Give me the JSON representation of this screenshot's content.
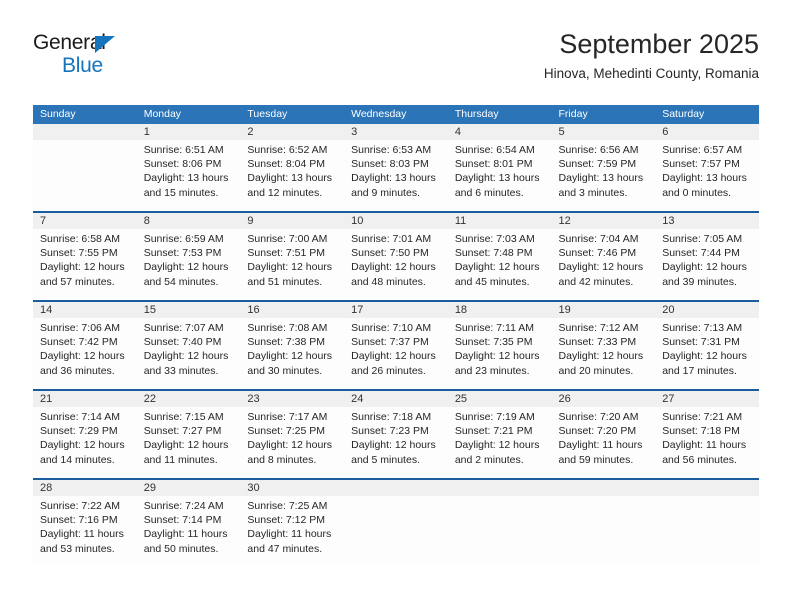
{
  "brand": {
    "name_top": "General",
    "name_bottom": "Blue",
    "accent_color": "#1574bb"
  },
  "header": {
    "title": "September 2025",
    "subtitle": "Hinova, Mehedinti County, Romania"
  },
  "theme": {
    "header_bg": "#2b74b8",
    "week_divider": "#1b5c9e",
    "daynum_bg": "#f0f0f0",
    "cell_bg": "#fdfdfd"
  },
  "calendar": {
    "weekday_headers": [
      "Sunday",
      "Monday",
      "Tuesday",
      "Wednesday",
      "Thursday",
      "Friday",
      "Saturday"
    ],
    "weeks": [
      [
        {
          "day": ""
        },
        {
          "day": "1",
          "sunrise": "Sunrise: 6:51 AM",
          "sunset": "Sunset: 8:06 PM",
          "daylight_l1": "Daylight: 13 hours",
          "daylight_l2": "and 15 minutes."
        },
        {
          "day": "2",
          "sunrise": "Sunrise: 6:52 AM",
          "sunset": "Sunset: 8:04 PM",
          "daylight_l1": "Daylight: 13 hours",
          "daylight_l2": "and 12 minutes."
        },
        {
          "day": "3",
          "sunrise": "Sunrise: 6:53 AM",
          "sunset": "Sunset: 8:03 PM",
          "daylight_l1": "Daylight: 13 hours",
          "daylight_l2": "and 9 minutes."
        },
        {
          "day": "4",
          "sunrise": "Sunrise: 6:54 AM",
          "sunset": "Sunset: 8:01 PM",
          "daylight_l1": "Daylight: 13 hours",
          "daylight_l2": "and 6 minutes."
        },
        {
          "day": "5",
          "sunrise": "Sunrise: 6:56 AM",
          "sunset": "Sunset: 7:59 PM",
          "daylight_l1": "Daylight: 13 hours",
          "daylight_l2": "and 3 minutes."
        },
        {
          "day": "6",
          "sunrise": "Sunrise: 6:57 AM",
          "sunset": "Sunset: 7:57 PM",
          "daylight_l1": "Daylight: 13 hours",
          "daylight_l2": "and 0 minutes."
        }
      ],
      [
        {
          "day": "7",
          "sunrise": "Sunrise: 6:58 AM",
          "sunset": "Sunset: 7:55 PM",
          "daylight_l1": "Daylight: 12 hours",
          "daylight_l2": "and 57 minutes."
        },
        {
          "day": "8",
          "sunrise": "Sunrise: 6:59 AM",
          "sunset": "Sunset: 7:53 PM",
          "daylight_l1": "Daylight: 12 hours",
          "daylight_l2": "and 54 minutes."
        },
        {
          "day": "9",
          "sunrise": "Sunrise: 7:00 AM",
          "sunset": "Sunset: 7:51 PM",
          "daylight_l1": "Daylight: 12 hours",
          "daylight_l2": "and 51 minutes."
        },
        {
          "day": "10",
          "sunrise": "Sunrise: 7:01 AM",
          "sunset": "Sunset: 7:50 PM",
          "daylight_l1": "Daylight: 12 hours",
          "daylight_l2": "and 48 minutes."
        },
        {
          "day": "11",
          "sunrise": "Sunrise: 7:03 AM",
          "sunset": "Sunset: 7:48 PM",
          "daylight_l1": "Daylight: 12 hours",
          "daylight_l2": "and 45 minutes."
        },
        {
          "day": "12",
          "sunrise": "Sunrise: 7:04 AM",
          "sunset": "Sunset: 7:46 PM",
          "daylight_l1": "Daylight: 12 hours",
          "daylight_l2": "and 42 minutes."
        },
        {
          "day": "13",
          "sunrise": "Sunrise: 7:05 AM",
          "sunset": "Sunset: 7:44 PM",
          "daylight_l1": "Daylight: 12 hours",
          "daylight_l2": "and 39 minutes."
        }
      ],
      [
        {
          "day": "14",
          "sunrise": "Sunrise: 7:06 AM",
          "sunset": "Sunset: 7:42 PM",
          "daylight_l1": "Daylight: 12 hours",
          "daylight_l2": "and 36 minutes."
        },
        {
          "day": "15",
          "sunrise": "Sunrise: 7:07 AM",
          "sunset": "Sunset: 7:40 PM",
          "daylight_l1": "Daylight: 12 hours",
          "daylight_l2": "and 33 minutes."
        },
        {
          "day": "16",
          "sunrise": "Sunrise: 7:08 AM",
          "sunset": "Sunset: 7:38 PM",
          "daylight_l1": "Daylight: 12 hours",
          "daylight_l2": "and 30 minutes."
        },
        {
          "day": "17",
          "sunrise": "Sunrise: 7:10 AM",
          "sunset": "Sunset: 7:37 PM",
          "daylight_l1": "Daylight: 12 hours",
          "daylight_l2": "and 26 minutes."
        },
        {
          "day": "18",
          "sunrise": "Sunrise: 7:11 AM",
          "sunset": "Sunset: 7:35 PM",
          "daylight_l1": "Daylight: 12 hours",
          "daylight_l2": "and 23 minutes."
        },
        {
          "day": "19",
          "sunrise": "Sunrise: 7:12 AM",
          "sunset": "Sunset: 7:33 PM",
          "daylight_l1": "Daylight: 12 hours",
          "daylight_l2": "and 20 minutes."
        },
        {
          "day": "20",
          "sunrise": "Sunrise: 7:13 AM",
          "sunset": "Sunset: 7:31 PM",
          "daylight_l1": "Daylight: 12 hours",
          "daylight_l2": "and 17 minutes."
        }
      ],
      [
        {
          "day": "21",
          "sunrise": "Sunrise: 7:14 AM",
          "sunset": "Sunset: 7:29 PM",
          "daylight_l1": "Daylight: 12 hours",
          "daylight_l2": "and 14 minutes."
        },
        {
          "day": "22",
          "sunrise": "Sunrise: 7:15 AM",
          "sunset": "Sunset: 7:27 PM",
          "daylight_l1": "Daylight: 12 hours",
          "daylight_l2": "and 11 minutes."
        },
        {
          "day": "23",
          "sunrise": "Sunrise: 7:17 AM",
          "sunset": "Sunset: 7:25 PM",
          "daylight_l1": "Daylight: 12 hours",
          "daylight_l2": "and 8 minutes."
        },
        {
          "day": "24",
          "sunrise": "Sunrise: 7:18 AM",
          "sunset": "Sunset: 7:23 PM",
          "daylight_l1": "Daylight: 12 hours",
          "daylight_l2": "and 5 minutes."
        },
        {
          "day": "25",
          "sunrise": "Sunrise: 7:19 AM",
          "sunset": "Sunset: 7:21 PM",
          "daylight_l1": "Daylight: 12 hours",
          "daylight_l2": "and 2 minutes."
        },
        {
          "day": "26",
          "sunrise": "Sunrise: 7:20 AM",
          "sunset": "Sunset: 7:20 PM",
          "daylight_l1": "Daylight: 11 hours",
          "daylight_l2": "and 59 minutes."
        },
        {
          "day": "27",
          "sunrise": "Sunrise: 7:21 AM",
          "sunset": "Sunset: 7:18 PM",
          "daylight_l1": "Daylight: 11 hours",
          "daylight_l2": "and 56 minutes."
        }
      ],
      [
        {
          "day": "28",
          "sunrise": "Sunrise: 7:22 AM",
          "sunset": "Sunset: 7:16 PM",
          "daylight_l1": "Daylight: 11 hours",
          "daylight_l2": "and 53 minutes."
        },
        {
          "day": "29",
          "sunrise": "Sunrise: 7:24 AM",
          "sunset": "Sunset: 7:14 PM",
          "daylight_l1": "Daylight: 11 hours",
          "daylight_l2": "and 50 minutes."
        },
        {
          "day": "30",
          "sunrise": "Sunrise: 7:25 AM",
          "sunset": "Sunset: 7:12 PM",
          "daylight_l1": "Daylight: 11 hours",
          "daylight_l2": "and 47 minutes."
        },
        {
          "day": ""
        },
        {
          "day": ""
        },
        {
          "day": ""
        },
        {
          "day": ""
        }
      ]
    ]
  }
}
